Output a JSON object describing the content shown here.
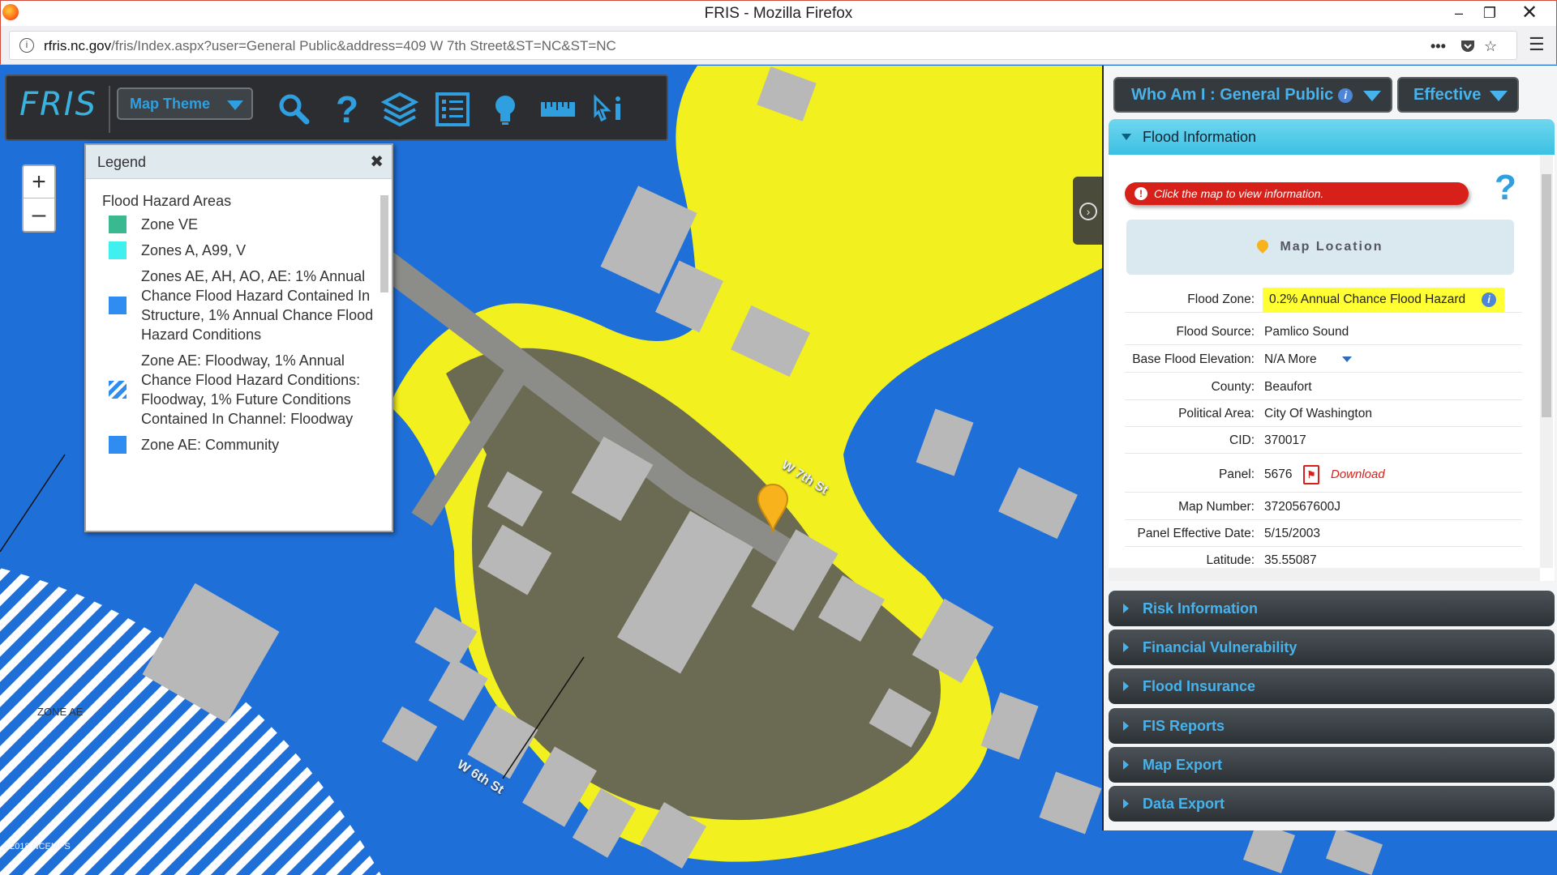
{
  "window": {
    "title": "FRIS - Mozilla Firefox"
  },
  "browser": {
    "url_host": "rfris.nc.gov",
    "url_path": "/fris/Index.aspx?user=General Public&address=409 W 7th Street&ST=NC&ST=NC",
    "url_prefix": ""
  },
  "toolbar": {
    "logo": "FRIS",
    "map_theme": "Map Theme"
  },
  "legend": {
    "title": "Legend",
    "group": "Flood Hazard Areas",
    "items": [
      {
        "label": "Zone VE",
        "color": "#3ab890"
      },
      {
        "label": "Zones A, A99, V",
        "color": "#3ff0ee"
      },
      {
        "label": "Zones AE, AH, AO, AE: 1% Annual Chance Flood Hazard Contained In Structure, 1% Annual Chance Flood Hazard Conditions",
        "color": "#2f8cf0"
      },
      {
        "label": "Zone AE: Floodway, 1% Annual Chance Flood Hazard Conditions: Floodway, 1% Future Conditions Contained In Channel: Floodway",
        "color": "hatch"
      },
      {
        "label": "Zone AE: Community",
        "color": "#2f8cf0"
      }
    ]
  },
  "panel": {
    "who_am_i": "Who Am I : General Public",
    "effective": "Effective",
    "flood_info_title": "Flood Information",
    "alert": "Click the map to view information.",
    "help": "?",
    "map_location": "Map Location",
    "flood_zone_label": "Flood Zone:",
    "flood_zone_value": "0.2% Annual Chance Flood Hazard",
    "rows": [
      {
        "k": "Flood Source:",
        "v": "Pamlico Sound"
      },
      {
        "k": "Base Flood Elevation:",
        "v": "N/A  More"
      },
      {
        "k": "County:",
        "v": "Beaufort"
      },
      {
        "k": "Political Area:",
        "v": "City Of Washington"
      },
      {
        "k": "CID:",
        "v": "370017"
      },
      {
        "k": "Panel:",
        "v": "5676"
      },
      {
        "k": "Map Number:",
        "v": "3720567600J"
      },
      {
        "k": "Panel Effective Date:",
        "v": "5/15/2003"
      },
      {
        "k": "Latitude:",
        "v": "35.55087"
      }
    ],
    "download": "Download",
    "sections": [
      "Risk Information",
      "Financial Vulnerability",
      "Flood Insurance",
      "FIS Reports",
      "Map Export",
      "Data Export"
    ]
  },
  "map": {
    "zone_label": "ZONE AE",
    "street_7th": "W 7th St",
    "street_6th": "W 6th St",
    "copyright": "©2018 NCEMPS",
    "colors": {
      "ae": "#1f6fd8",
      "x500": "#f2f01e",
      "building": "#b8b8b8"
    }
  }
}
